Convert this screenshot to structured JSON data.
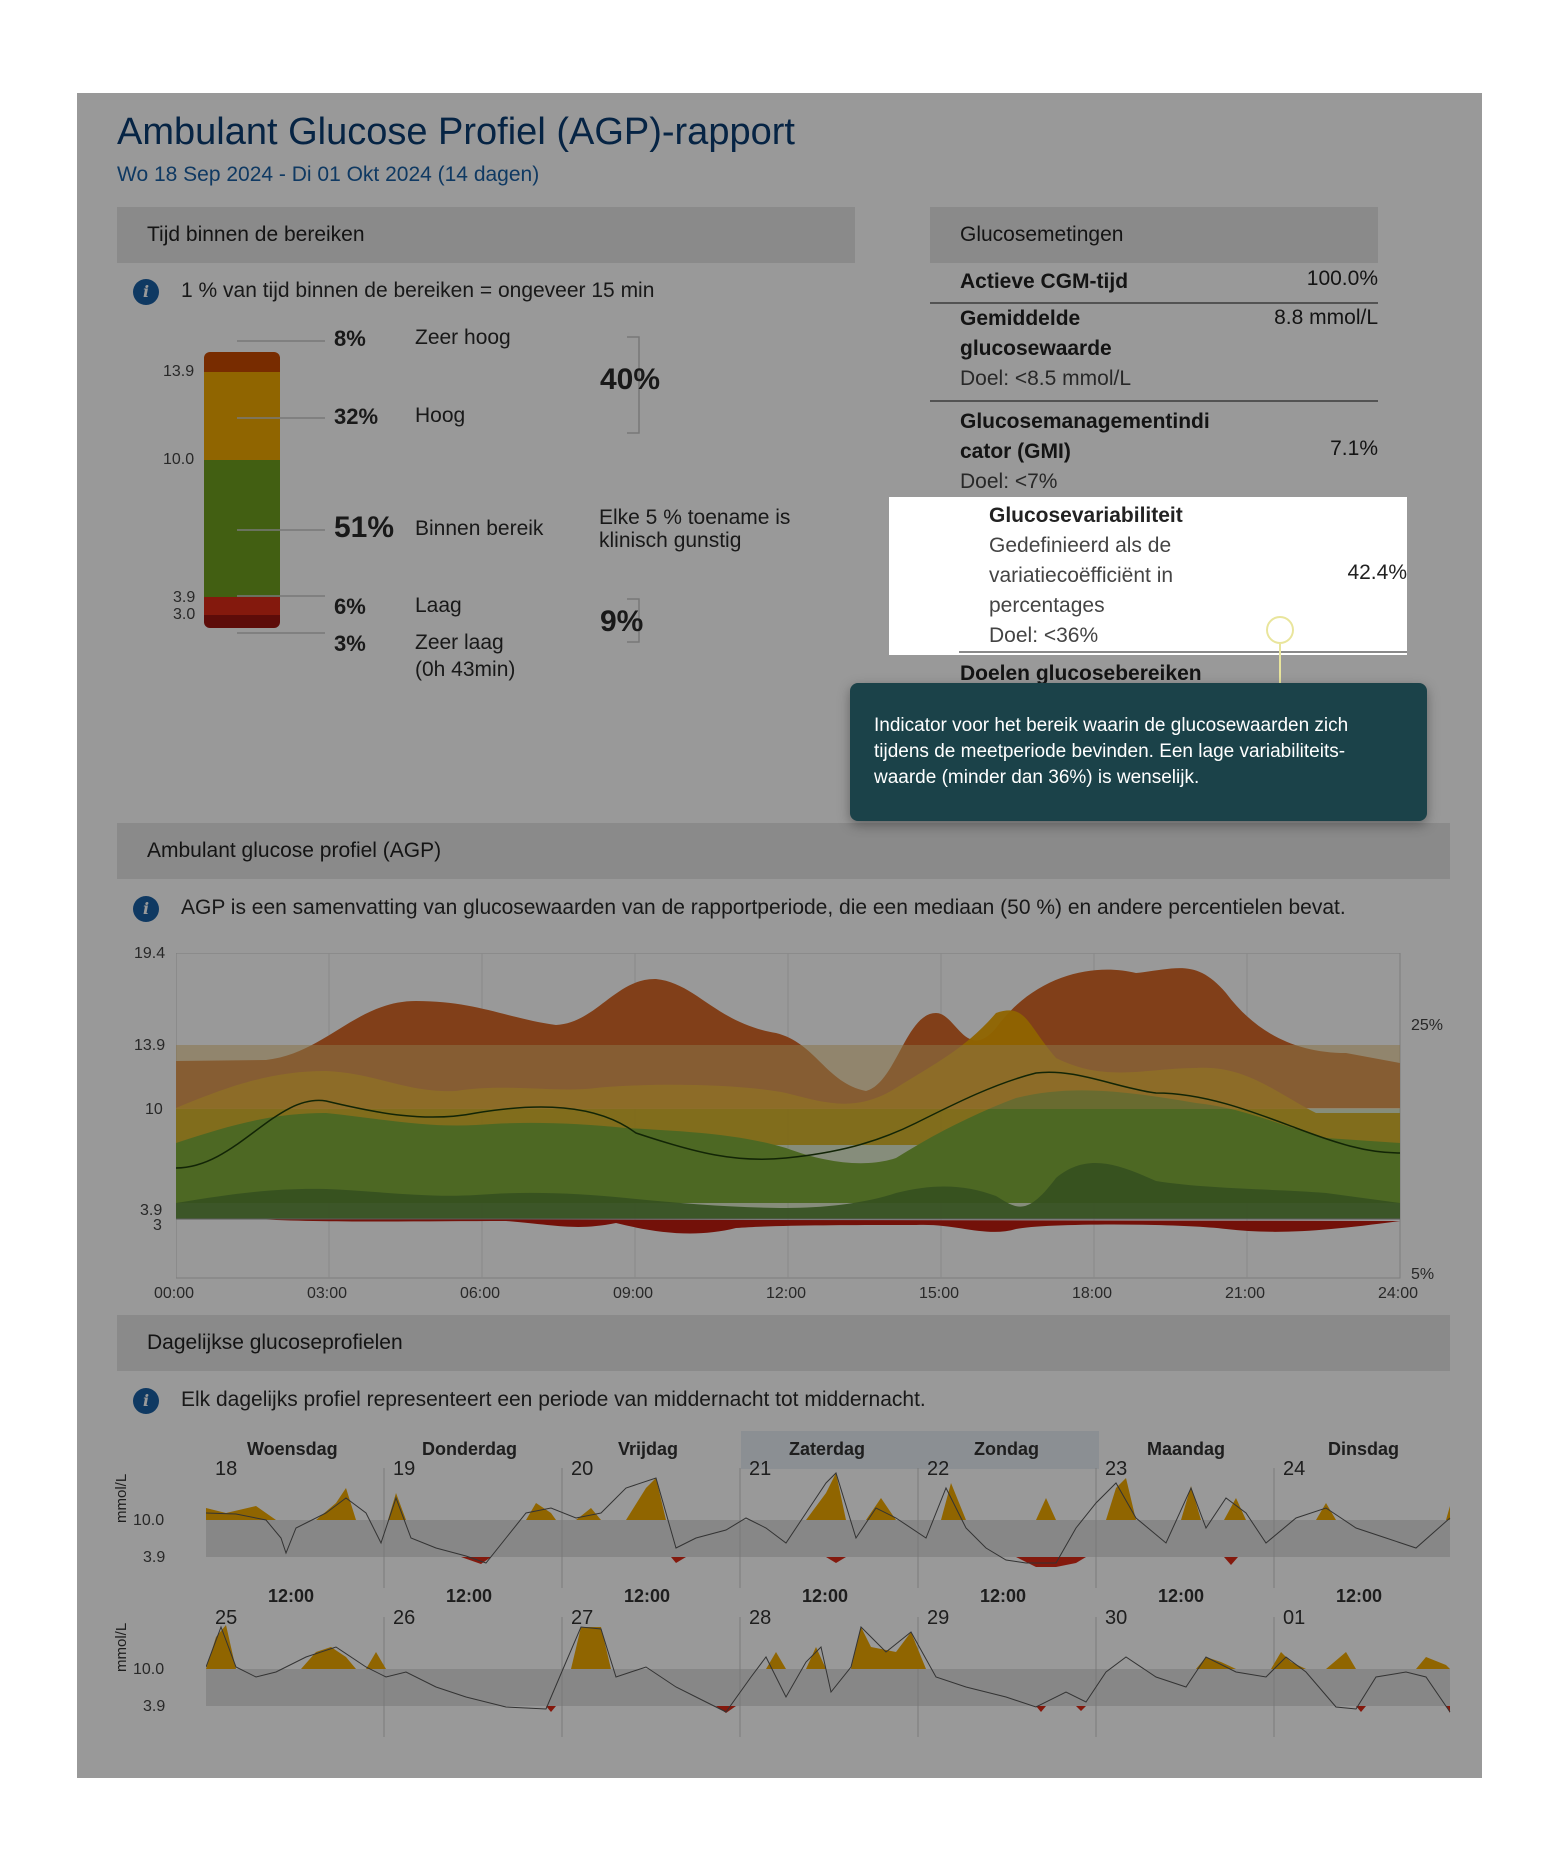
{
  "header": {
    "title": "Ambulant Glucose Profiel (AGP)-rapport",
    "period": "Wo 18 Sep 2024 - Di 01 Okt 2024 (14 dagen)"
  },
  "tir": {
    "heading": "Tijd binnen de bereiken",
    "info": "1 % van tijd binnen de bereiken = ongeveer 15 min",
    "ticks": [
      "13.9",
      "10.0",
      "3.9",
      "3.0"
    ],
    "segments": [
      {
        "pct": "8%",
        "label": "Zeer hoog",
        "color": "#c84a00"
      },
      {
        "pct": "32%",
        "label": "Hoog",
        "color": "#f0a800"
      },
      {
        "pct": "51%",
        "label": "Binnen bereik",
        "color": "#6e9f1e"
      },
      {
        "pct": "6%",
        "label": "Laag",
        "color": "#dc2a17"
      },
      {
        "pct": "3%",
        "label": "Zeer laag",
        "color": "#9b1410"
      }
    ],
    "very_low_time": "(0h 43min)",
    "high_total": "40%",
    "low_total": "9%",
    "note_line1": "Elke 5 % toename is",
    "note_line2": "klinisch gunstig"
  },
  "glucose": {
    "heading": "Glucosemetingen",
    "cgm_label": "Actieve CGM-tijd",
    "cgm_value": "100.0%",
    "mean_label_1": "Gemiddelde",
    "mean_label_2": "glucosewaarde",
    "mean_goal": "Doel: <8.5 mmol/L",
    "mean_value": "8.8 mmol/L",
    "gmi_label_1": "Glucosemanagementindi",
    "gmi_label_2": "cator (GMI)",
    "gmi_goal": "Doel: <7%",
    "gmi_value": "7.1%",
    "cv_label": "Glucosevariabiliteit",
    "cv_desc_1": "Gedefinieerd als de",
    "cv_desc_2": "variatiecoëfficiënt in",
    "cv_desc_3": "percentages",
    "cv_goal": "Doel: <36%",
    "cv_value": "42.4%",
    "targets_label": "Doelen glucosebereiken"
  },
  "tooltip": {
    "line1": "Indicator voor het bereik waarin de glucosewaarden zich",
    "line2": "tijdens de meetperiode bevinden. Een lage variabiliteits-",
    "line3": "waarde (minder dan 36%) is wenselijk."
  },
  "agp": {
    "heading": "Ambulant glucose profiel (AGP)",
    "info": "AGP is een samenvatting van glucosewaarden van de rapportperiode, die een mediaan (50 %) en andere percentielen bevat.",
    "y_ticks": [
      "19.4",
      "13.9",
      "10",
      "3.9",
      "3"
    ],
    "x_ticks": [
      "00:00",
      "03:00",
      "06:00",
      "09:00",
      "12:00",
      "15:00",
      "18:00",
      "21:00",
      "24:00"
    ],
    "right_labels": [
      "25%",
      "5%"
    ]
  },
  "daily": {
    "heading": "Dagelijkse glucoseprofielen",
    "info": "Elk dagelijks profiel representeert een periode van middernacht tot middernacht.",
    "weekdays": [
      "Woensdag",
      "Donderdag",
      "Vrijdag",
      "Zaterdag",
      "Zondag",
      "Maandag",
      "Dinsdag"
    ],
    "week1_dates": [
      "18",
      "19",
      "20",
      "21",
      "22",
      "23",
      "24"
    ],
    "week2_dates": [
      "25",
      "26",
      "27",
      "28",
      "29",
      "30",
      "01"
    ],
    "noon_label": "12:00",
    "y_unit": "mmol/L",
    "y_ticks": [
      "10.0",
      "3.9"
    ]
  },
  "colors": {
    "title": "#0b3c72",
    "very_high": "#c84a00",
    "high": "#f0a800",
    "in_range": "#6e9f1e",
    "low": "#dc2a17",
    "very_low": "#9b1410",
    "tooltip_bg": "#1b4249"
  }
}
